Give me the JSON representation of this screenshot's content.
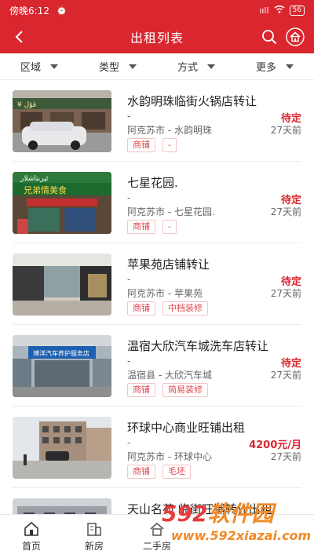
{
  "status_bar": {
    "time": "傍晚6:12",
    "signal": "ııll",
    "battery": "56"
  },
  "header": {
    "title": "出租列表"
  },
  "filters": [
    {
      "label": "区域"
    },
    {
      "label": "类型"
    },
    {
      "label": "方式"
    },
    {
      "label": "更多"
    }
  ],
  "listings": [
    {
      "title": "水韵明珠临街火锅店转让",
      "subtitle": "-",
      "price": "待定",
      "location": "阿克苏市 - 水韵明珠",
      "time": "27天前",
      "tags": [
        "商铺",
        "-"
      ]
    },
    {
      "title": "七星花园.",
      "subtitle": "-",
      "price": "待定",
      "location": "阿克苏市 - 七星花园.",
      "time": "27天前",
      "tags": [
        "商铺",
        "-"
      ]
    },
    {
      "title": "苹果苑店铺转让",
      "subtitle": "-",
      "price": "待定",
      "location": "阿克苏市 - 苹果苑",
      "time": "27天前",
      "tags": [
        "商铺",
        "中档装修"
      ]
    },
    {
      "title": "温宿大欣汽车城洗车店转让",
      "subtitle": "-",
      "price": "待定",
      "location": "温宿县 - 大欣汽车城",
      "time": "27天前",
      "tags": [
        "商铺",
        "简易装修"
      ]
    },
    {
      "title": "环球中心商业旺铺出租",
      "subtitle": "-",
      "price": "4200元/月",
      "location": "阿克苏市 - 环球中心",
      "time": "27天前",
      "tags": [
        "商铺",
        "毛坯"
      ]
    },
    {
      "title": "天山名苑 临街旺铺转让出租",
      "subtitle": "",
      "price": "",
      "location": "",
      "time": "",
      "tags": []
    }
  ],
  "tabbar": [
    {
      "label": "首页",
      "icon": "home-icon"
    },
    {
      "label": "新房",
      "icon": "building-icon"
    },
    {
      "label": "二手房",
      "icon": "house-icon"
    }
  ],
  "watermark": {
    "brand_number": "592",
    "brand_text": "软件园",
    "url": "www.592xiazai.com"
  },
  "colors": {
    "accent": "#d9262f",
    "tag_text": "#e0474f",
    "tag_border": "#f3c4c6"
  }
}
